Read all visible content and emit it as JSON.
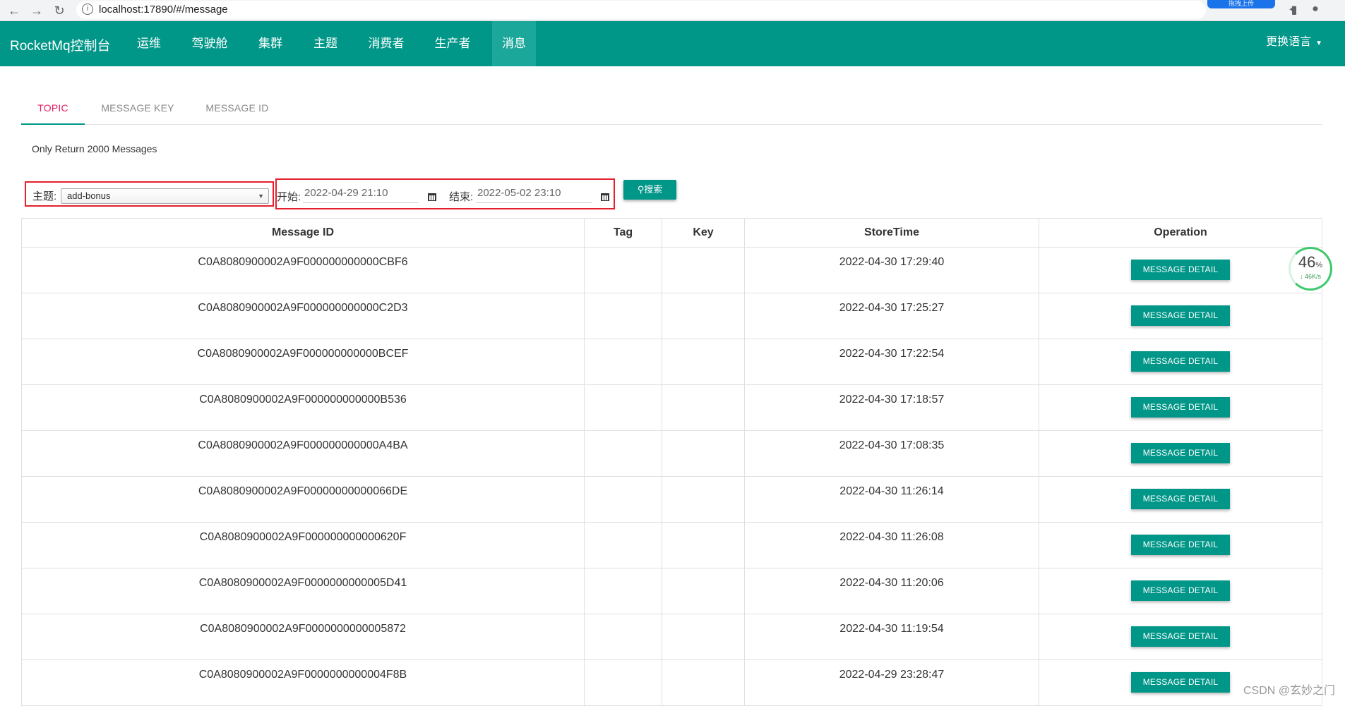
{
  "browser": {
    "url": "localhost:17890/#/message",
    "info_icon": "i",
    "back_icon": "←",
    "forward_icon": "→",
    "reload_icon": "↻",
    "extension_label": "拖拽上传"
  },
  "navbar": {
    "brand": "RocketMq控制台",
    "items": [
      {
        "label": "运维"
      },
      {
        "label": "驾驶舱"
      },
      {
        "label": "集群"
      },
      {
        "label": "主题"
      },
      {
        "label": "消费者"
      },
      {
        "label": "生产者"
      },
      {
        "label": "消息"
      }
    ],
    "active_item": "消息",
    "language_label": "更换语言"
  },
  "tabs": [
    {
      "label": "TOPIC"
    },
    {
      "label": "MESSAGE KEY"
    },
    {
      "label": "MESSAGE ID"
    }
  ],
  "info_text": "Only Return 2000 Messages",
  "search": {
    "topic_label": "主题:",
    "topic_value": "add-bonus",
    "start_label": "开始:",
    "start_value": "2022-04-29 21:10",
    "end_label": "结束:",
    "end_value": "2022-05-02 23:10",
    "search_button": "搜索"
  },
  "table": {
    "columns": [
      "Message ID",
      "Tag",
      "Key",
      "StoreTime",
      "Operation"
    ],
    "detail_button": "MESSAGE DETAIL",
    "rows": [
      {
        "id": "C0A8080900002A9F000000000000CBF6",
        "tag": "",
        "key": "",
        "time": "2022-04-30 17:29:40"
      },
      {
        "id": "C0A8080900002A9F000000000000C2D3",
        "tag": "",
        "key": "",
        "time": "2022-04-30 17:25:27"
      },
      {
        "id": "C0A8080900002A9F000000000000BCEF",
        "tag": "",
        "key": "",
        "time": "2022-04-30 17:22:54"
      },
      {
        "id": "C0A8080900002A9F000000000000B536",
        "tag": "",
        "key": "",
        "time": "2022-04-30 17:18:57"
      },
      {
        "id": "C0A8080900002A9F000000000000A4BA",
        "tag": "",
        "key": "",
        "time": "2022-04-30 17:08:35"
      },
      {
        "id": "C0A8080900002A9F00000000000066DE",
        "tag": "",
        "key": "",
        "time": "2022-04-30 11:26:14"
      },
      {
        "id": "C0A8080900002A9F000000000000620F",
        "tag": "",
        "key": "",
        "time": "2022-04-30 11:26:08"
      },
      {
        "id": "C0A8080900002A9F0000000000005D41",
        "tag": "",
        "key": "",
        "time": "2022-04-30 11:20:06"
      },
      {
        "id": "C0A8080900002A9F0000000000005872",
        "tag": "",
        "key": "",
        "time": "2022-04-30 11:19:54"
      },
      {
        "id": "C0A8080900002A9F0000000000004F8B",
        "tag": "",
        "key": "",
        "time": "2022-04-29 23:28:47"
      }
    ]
  },
  "speed_widget": {
    "percent": "46",
    "percent_sign": "%",
    "rate": "↓ 46K/s"
  },
  "watermark": "CSDN @玄妙之门",
  "colors": {
    "accent": "#009688",
    "active_tab": "#e91e63",
    "highlight_box": "#e5202e"
  }
}
